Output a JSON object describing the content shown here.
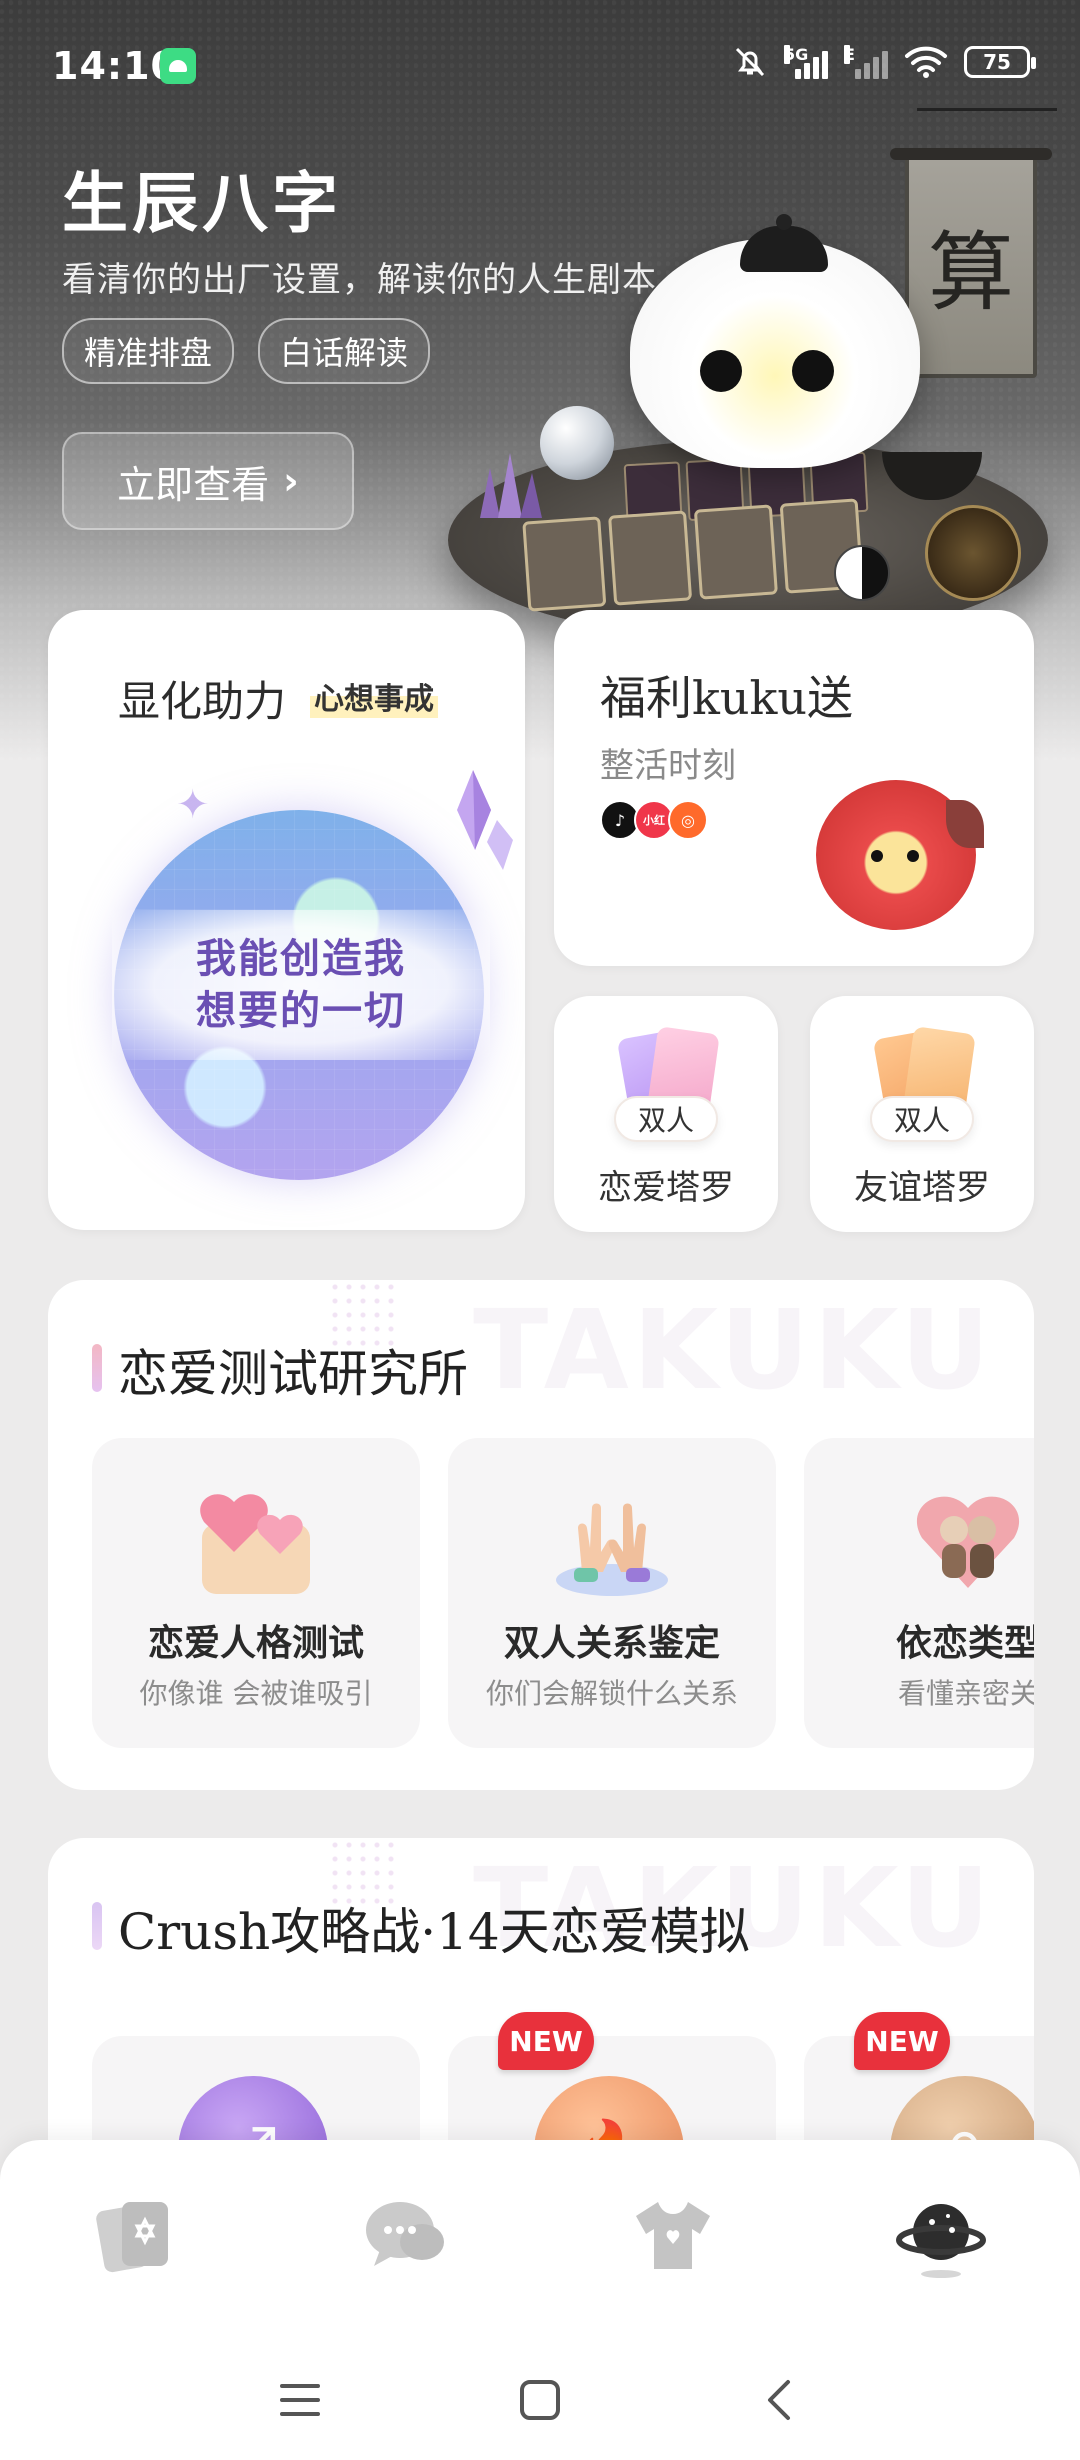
{
  "status_bar": {
    "time": "14:10",
    "network": "5G",
    "network2": "E",
    "battery": "75"
  },
  "hero": {
    "title": "生辰八字",
    "subtitle": "看清你的出厂设置，解读你的人生剧本",
    "tags": [
      "精准排盘",
      "白话解读"
    ],
    "cta_label": "立即查看",
    "scroll_char": "算"
  },
  "manifest_card": {
    "title": "显化助力",
    "badge": "心想事成",
    "line1": "我能创造我",
    "line2": "想要的一切"
  },
  "welfare_card": {
    "title": "福利kuku送",
    "subtitle": "整活时刻",
    "platform_icon_2": "小红"
  },
  "tarot_cards": [
    {
      "badge": "双人",
      "label": "恋爱塔罗"
    },
    {
      "badge": "双人",
      "label": "友谊塔罗"
    }
  ],
  "love_lab": {
    "title": "恋爱测试研究所",
    "watermark": "TAKUKU",
    "items": [
      {
        "title": "恋爱人格测试",
        "subtitle": "你像谁 会被谁吸引"
      },
      {
        "title": "双人关系鉴定",
        "subtitle": "你们会解锁什么关系"
      },
      {
        "title": "依恋类型",
        "subtitle": "看懂亲密关"
      }
    ]
  },
  "crush": {
    "title": "Crush攻略战·14天恋爱模拟",
    "watermark": "TAKUKU",
    "new_label": "NEW",
    "coin_symbols": [
      "♐",
      "🔥",
      "♎"
    ]
  },
  "colors": {
    "accent_purple": "#6a4fb3",
    "new_red": "#e8313c",
    "card_bg": "#ffffff",
    "page_bg": "#ecebeb"
  },
  "icons": {
    "nav": [
      "tarot-cards-icon",
      "chat-bubbles-icon",
      "tshirt-icon",
      "planet-icon"
    ],
    "system": [
      "menu-icon",
      "home-square-icon",
      "back-chevron-icon"
    ]
  }
}
